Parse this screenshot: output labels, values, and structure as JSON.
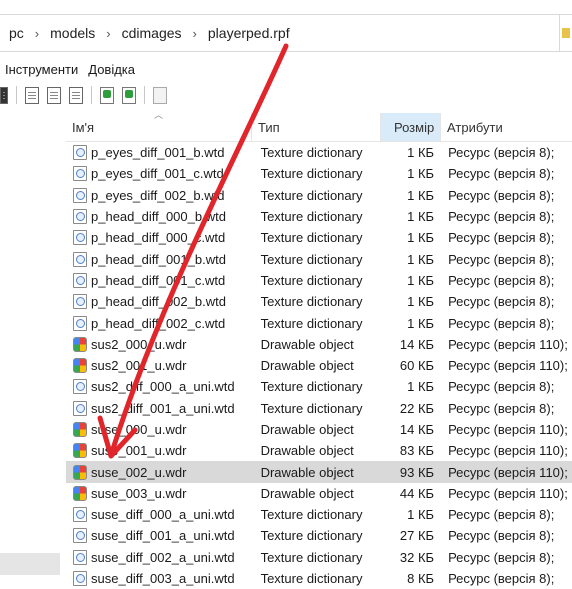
{
  "address": {
    "segments": [
      "pc",
      "models",
      "cdimages",
      "playerped.rpf"
    ],
    "separator": "›"
  },
  "menu": [
    "Інструменти",
    "Довідка"
  ],
  "columns": {
    "name": "Ім'я",
    "type": "Тип",
    "size": "Розмір",
    "attributes": "Атрибути"
  },
  "files": [
    {
      "name": "p_eyes_diff_001_b.wtd",
      "type": "Texture dictionary",
      "size": "1 КБ",
      "attr": "Ресурс (версія 8);",
      "icon": "wtd-file-icon"
    },
    {
      "name": "p_eyes_diff_001_c.wtd",
      "type": "Texture dictionary",
      "size": "1 КБ",
      "attr": "Ресурс (версія 8);",
      "icon": "wtd-file-icon"
    },
    {
      "name": "p_eyes_diff_002_b.wtd",
      "type": "Texture dictionary",
      "size": "1 КБ",
      "attr": "Ресурс (версія 8);",
      "icon": "wtd-file-icon"
    },
    {
      "name": "p_head_diff_000_b.wtd",
      "type": "Texture dictionary",
      "size": "1 КБ",
      "attr": "Ресурс (версія 8);",
      "icon": "wtd-file-icon"
    },
    {
      "name": "p_head_diff_000_c.wtd",
      "type": "Texture dictionary",
      "size": "1 КБ",
      "attr": "Ресурс (версія 8);",
      "icon": "wtd-file-icon"
    },
    {
      "name": "p_head_diff_001_b.wtd",
      "type": "Texture dictionary",
      "size": "1 КБ",
      "attr": "Ресурс (версія 8);",
      "icon": "wtd-file-icon"
    },
    {
      "name": "p_head_diff_001_c.wtd",
      "type": "Texture dictionary",
      "size": "1 КБ",
      "attr": "Ресурс (версія 8);",
      "icon": "wtd-file-icon"
    },
    {
      "name": "p_head_diff_002_b.wtd",
      "type": "Texture dictionary",
      "size": "1 КБ",
      "attr": "Ресурс (версія 8);",
      "icon": "wtd-file-icon"
    },
    {
      "name": "p_head_diff_002_c.wtd",
      "type": "Texture dictionary",
      "size": "1 КБ",
      "attr": "Ресурс (версія 8);",
      "icon": "wtd-file-icon"
    },
    {
      "name": "sus2_000_u.wdr",
      "type": "Drawable object",
      "size": "14 КБ",
      "attr": "Ресурс (версія 110);",
      "icon": "wdr-file-icon"
    },
    {
      "name": "sus2_001_u.wdr",
      "type": "Drawable object",
      "size": "60 КБ",
      "attr": "Ресурс (версія 110);",
      "icon": "wdr-file-icon"
    },
    {
      "name": "sus2_diff_000_a_uni.wtd",
      "type": "Texture dictionary",
      "size": "1 КБ",
      "attr": "Ресурс (версія 8);",
      "icon": "wtd-file-icon"
    },
    {
      "name": "sus2_diff_001_a_uni.wtd",
      "type": "Texture dictionary",
      "size": "22 КБ",
      "attr": "Ресурс (версія 8);",
      "icon": "wtd-file-icon"
    },
    {
      "name": "suse_000_u.wdr",
      "type": "Drawable object",
      "size": "14 КБ",
      "attr": "Ресурс (версія 110);",
      "icon": "wdr-file-icon"
    },
    {
      "name": "suse_001_u.wdr",
      "type": "Drawable object",
      "size": "83 КБ",
      "attr": "Ресурс (версія 110);",
      "icon": "wdr-file-icon"
    },
    {
      "name": "suse_002_u.wdr",
      "type": "Drawable object",
      "size": "93 КБ",
      "attr": "Ресурс (версія 110);",
      "icon": "wdr-file-icon",
      "selected": true
    },
    {
      "name": "suse_003_u.wdr",
      "type": "Drawable object",
      "size": "44 КБ",
      "attr": "Ресурс (версія 110);",
      "icon": "wdr-file-icon"
    },
    {
      "name": "suse_diff_000_a_uni.wtd",
      "type": "Texture dictionary",
      "size": "1 КБ",
      "attr": "Ресурс (версія 8);",
      "icon": "wtd-file-icon"
    },
    {
      "name": "suse_diff_001_a_uni.wtd",
      "type": "Texture dictionary",
      "size": "27 КБ",
      "attr": "Ресурс (версія 8);",
      "icon": "wtd-file-icon"
    },
    {
      "name": "suse_diff_002_a_uni.wtd",
      "type": "Texture dictionary",
      "size": "32 КБ",
      "attr": "Ресурс (версія 8);",
      "icon": "wtd-file-icon"
    },
    {
      "name": "suse_diff_003_a_uni.wtd",
      "type": "Texture dictionary",
      "size": "8 КБ",
      "attr": "Ресурс (версія 8);",
      "icon": "wtd-file-icon"
    }
  ],
  "colors": {
    "annotation_arrow": "#e0262b",
    "selected_row": "#d9d9d9",
    "sorted_column": "#d9ebf9"
  }
}
